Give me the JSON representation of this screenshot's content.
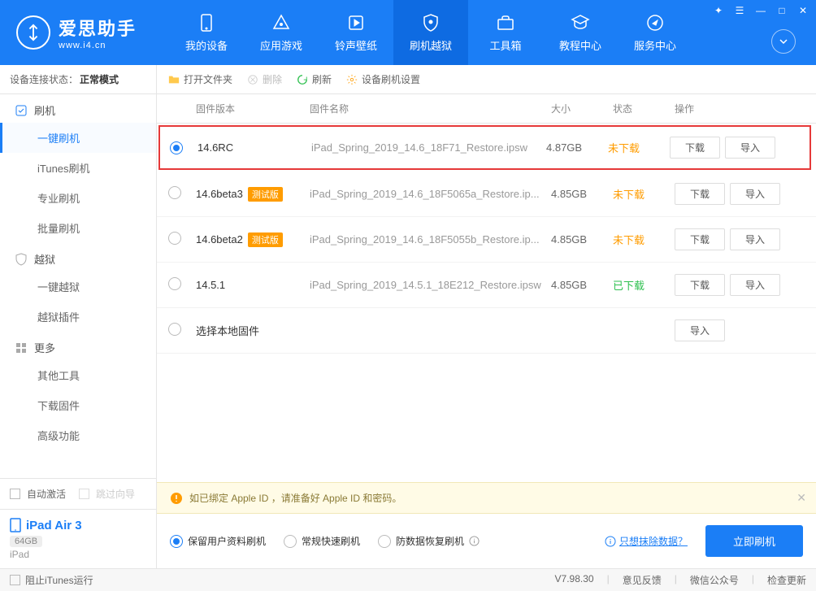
{
  "app": {
    "title": "爱思助手",
    "subtitle": "www.i4.cn"
  },
  "nav": [
    {
      "label": "我的设备",
      "icon": "device"
    },
    {
      "label": "应用游戏",
      "icon": "app"
    },
    {
      "label": "铃声壁纸",
      "icon": "music"
    },
    {
      "label": "刷机越狱",
      "icon": "shield",
      "active": true
    },
    {
      "label": "工具箱",
      "icon": "toolbox"
    },
    {
      "label": "教程中心",
      "icon": "edu"
    },
    {
      "label": "服务中心",
      "icon": "compass"
    }
  ],
  "conn": {
    "label": "设备连接状态：",
    "value": "正常模式"
  },
  "sidebar": {
    "sections": [
      {
        "title": "刷机",
        "items": [
          "一键刷机",
          "iTunes刷机",
          "专业刷机",
          "批量刷机"
        ],
        "active_index": 0
      },
      {
        "title": "越狱",
        "items": [
          "一键越狱",
          "越狱插件"
        ]
      },
      {
        "title": "更多",
        "items": [
          "其他工具",
          "下载固件",
          "高级功能"
        ]
      }
    ],
    "auto_activate": "自动激活",
    "skip_guide": "跳过向导"
  },
  "device": {
    "name": "iPad Air 3",
    "storage": "64GB",
    "type": "iPad"
  },
  "toolbar": {
    "open": "打开文件夹",
    "delete": "删除",
    "refresh": "刷新",
    "settings": "设备刷机设置"
  },
  "table": {
    "headers": {
      "version": "固件版本",
      "name": "固件名称",
      "size": "大小",
      "status": "状态",
      "ops": "操作"
    },
    "rows": [
      {
        "selected": true,
        "highlighted": true,
        "version": "14.6RC",
        "beta": false,
        "name": "iPad_Spring_2019_14.6_18F71_Restore.ipsw",
        "size": "4.87GB",
        "status": "未下载",
        "status_class": "st-not",
        "download": true,
        "import": true
      },
      {
        "selected": false,
        "version": "14.6beta3",
        "beta": true,
        "name": "iPad_Spring_2019_14.6_18F5065a_Restore.ip...",
        "size": "4.85GB",
        "status": "未下载",
        "status_class": "st-not",
        "download": true,
        "import": true
      },
      {
        "selected": false,
        "version": "14.6beta2",
        "beta": true,
        "name": "iPad_Spring_2019_14.6_18F5055b_Restore.ip...",
        "size": "4.85GB",
        "status": "未下载",
        "status_class": "st-not",
        "download": true,
        "import": true
      },
      {
        "selected": false,
        "version": "14.5.1",
        "beta": false,
        "name": "iPad_Spring_2019_14.5.1_18E212_Restore.ipsw",
        "size": "4.85GB",
        "status": "已下载",
        "status_class": "st-done",
        "download": true,
        "import": true
      },
      {
        "selected": false,
        "version": "选择本地固件",
        "beta": false,
        "name": "",
        "size": "",
        "status": "",
        "status_class": "",
        "download": false,
        "import": true
      }
    ],
    "beta_tag": "测试版",
    "btn_download": "下载",
    "btn_import": "导入"
  },
  "warn": {
    "text": "如已绑定 Apple ID ，请准备好 Apple ID 和密码。"
  },
  "action": {
    "opts": [
      "保留用户资料刷机",
      "常规快速刷机",
      "防数据恢复刷机"
    ],
    "selected": 0,
    "erase_link": "只想抹除数据？",
    "flash_btn": "立即刷机"
  },
  "footer": {
    "block_itunes": "阻止iTunes运行",
    "version": "V7.98.30",
    "links": [
      "意见反馈",
      "微信公众号",
      "检查更新"
    ]
  }
}
